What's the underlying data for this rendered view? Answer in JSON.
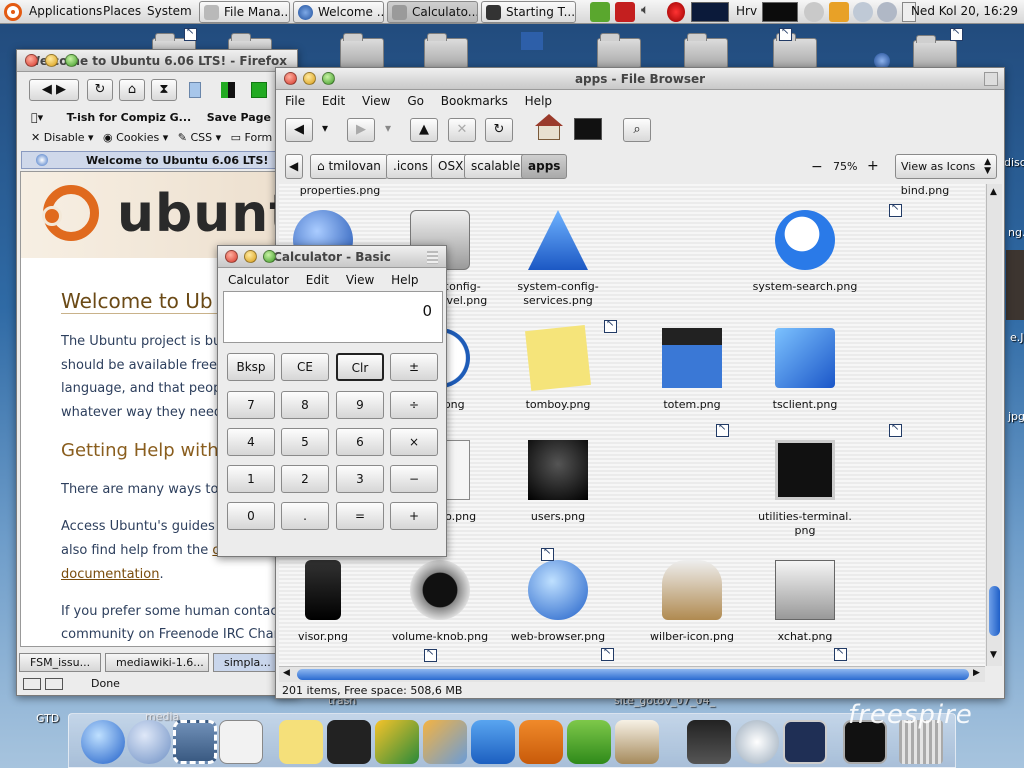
{
  "top_panel": {
    "menus": [
      "Applications",
      "Places",
      "System"
    ],
    "tasks": [
      {
        "label": "File Mana...",
        "icon": "file-manager-icon"
      },
      {
        "label": "Welcome ...",
        "icon": "firefox-icon"
      },
      {
        "label": "Calculato...",
        "icon": "calculator-icon"
      },
      {
        "label": "Starting T...",
        "icon": "terminal-icon"
      }
    ],
    "keyboard_layout": "Hrv",
    "clock": "Ned Kol 20, 16:29"
  },
  "desktop": {
    "labels": [
      "GTD",
      "media",
      "trash",
      "site_gotov_07_04_",
      "ng.gif",
      "e.JPG",
      "jpg",
      "disc"
    ]
  },
  "firefox": {
    "title": "Welcome to Ubuntu 6.06 LTS! - Firefox",
    "bookmarks_row1": [
      "T-ish for Compiz G...",
      "Save Page (s"
    ],
    "bookmarks_row2": [
      "Disable ▾",
      "Cookies ▾",
      "CSS ▾",
      "Form"
    ],
    "tab_title": "Welcome to Ubuntu 6.06 LTS!",
    "page": {
      "logo_word": "ubunt",
      "heading": "Welcome to Ub",
      "para1": [
        "The Ubuntu project is bu",
        "should be available free o",
        "language, and that peopl",
        "whatever way they need."
      ],
      "heading2": "Getting Help with",
      "para2": "There are many ways to g",
      "para3": [
        "Access Ubuntu's guides a",
        "also find help from the ",
        "documentation"
      ],
      "para3_link": "o",
      "para4": [
        "If you prefer some human contact,",
        "community on Freenode IRC Chann"
      ]
    },
    "bottom_tabs": [
      "FSM_issu...",
      "mediawiki-1.6...",
      "simpla..."
    ],
    "status": "Done"
  },
  "file_browser": {
    "title": "apps - File Browser",
    "menu": [
      "File",
      "Edit",
      "View",
      "Go",
      "Bookmarks",
      "Help"
    ],
    "path": [
      "tmilovan",
      ".icons",
      "OSX",
      "scalable",
      "apps"
    ],
    "zoom": "75%",
    "view_mode": "View as Icons",
    "top_labels": [
      "properties.png",
      "bind.png"
    ],
    "items": [
      {
        "label": "n-config-\nba.png",
        "icon": "samba-icon"
      },
      {
        "label": "system-config-\nsecuritylevel.png",
        "icon": "vault-icon"
      },
      {
        "label": "system-config-\nservices.png",
        "icon": "warning-icon"
      },
      {
        "label": "system-search.png",
        "icon": "search-icon"
      },
      {
        "label": "ditor.png",
        "icon": "editor-icon"
      },
      {
        "label": "time.png",
        "icon": "clock-icon"
      },
      {
        "label": "tomboy.png",
        "icon": "notes-icon"
      },
      {
        "label": "totem.png",
        "icon": "clapper-icon"
      },
      {
        "label": "tsclient.png",
        "icon": "tsclient-icon"
      },
      {
        "label": "-manager.\nng",
        "icon": "update-icon"
      },
      {
        "label": "user-info.png",
        "icon": "user-card-icon"
      },
      {
        "label": "users.png",
        "icon": "users-icon"
      },
      {
        "label": "utilities-terminal.\npng",
        "icon": "terminal-icon"
      },
      {
        "label": "visor.png",
        "icon": "phone-icon"
      },
      {
        "label": "volume-knob.png",
        "icon": "speaker-icon"
      },
      {
        "label": "web-browser.png",
        "icon": "globe-icon"
      },
      {
        "label": "wilber-icon.png",
        "icon": "gimp-icon"
      },
      {
        "label": "xchat.png",
        "icon": "xchat-icon"
      }
    ],
    "status": "201 items, Free space: 508,6 MB"
  },
  "calculator": {
    "title": "Calculator  - Basic",
    "menu": [
      "Calculator",
      "Edit",
      "View",
      "Help"
    ],
    "display": "0",
    "keys": [
      "Bksp",
      "CE",
      "Clr",
      "±",
      "7",
      "8",
      "9",
      "÷",
      "4",
      "5",
      "6",
      "×",
      "1",
      "2",
      "3",
      "−",
      "0",
      ".",
      "=",
      "+"
    ]
  },
  "dock": {
    "watermark": "freespire"
  },
  "colors": {
    "accent": "#3d6fb6",
    "ubuntu_orange": "#e06a1e",
    "link": "#7a4c0c"
  }
}
